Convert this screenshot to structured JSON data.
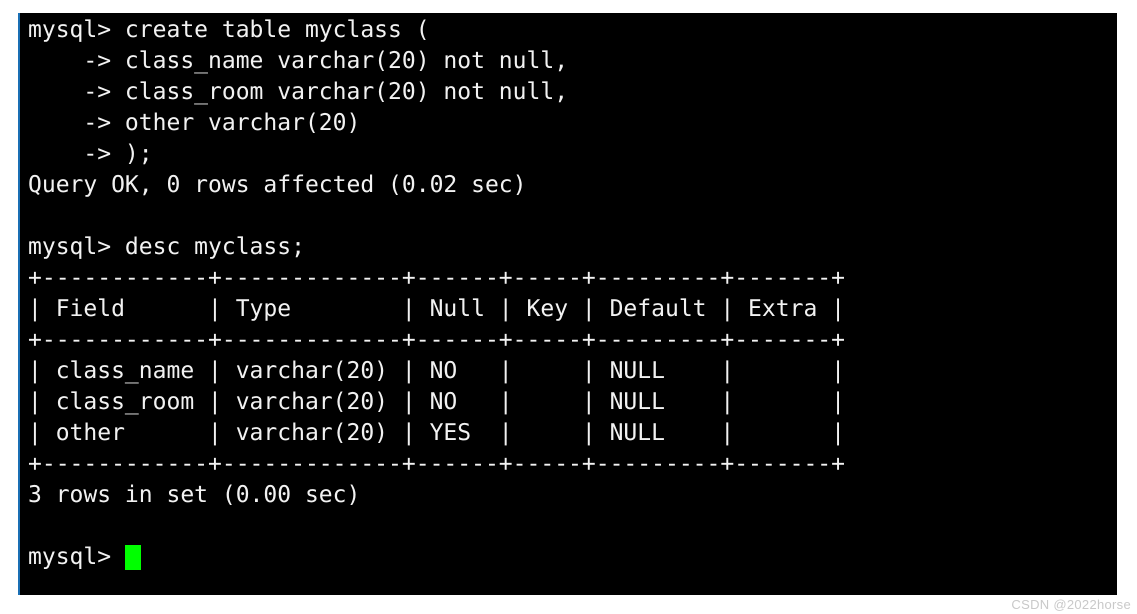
{
  "terminal": {
    "title": "mysql client session",
    "background_color": "#000000",
    "text_color": "#f2f2f2",
    "cursor_color": "#00ff00",
    "border_color": "#1a6fb4",
    "prompt": "mysql>",
    "continuation_prompt": "->",
    "lines": [
      "mysql> create table myclass (",
      "    -> class_name varchar(20) not null,",
      "    -> class_room varchar(20) not null,",
      "    -> other varchar(20)",
      "    -> );",
      "Query OK, 0 rows affected (0.02 sec)",
      "",
      "mysql> desc myclass;",
      "+------------+-------------+------+-----+---------+-------+",
      "| Field      | Type        | Null | Key | Default | Extra |",
      "+------------+-------------+------+-----+---------+-------+",
      "| class_name | varchar(20) | NO   |     | NULL    |       |",
      "| class_room | varchar(20) | NO   |     | NULL    |       |",
      "| other      | varchar(20) | YES  |     | NULL    |       |",
      "+------------+-------------+------+-----+---------+-------+",
      "3 rows in set (0.00 sec)",
      ""
    ],
    "final_prompt": "mysql> ",
    "cursor": "block-cursor"
  },
  "sql": {
    "create_statement": {
      "table_name": "myclass",
      "columns": [
        {
          "name": "class_name",
          "type": "varchar(20)",
          "constraint": "not null"
        },
        {
          "name": "class_room",
          "type": "varchar(20)",
          "constraint": "not null"
        },
        {
          "name": "other",
          "type": "varchar(20)",
          "constraint": ""
        }
      ],
      "result": "Query OK, 0 rows affected (0.02 sec)"
    },
    "desc_statement": {
      "command": "desc myclass;",
      "headers": [
        "Field",
        "Type",
        "Null",
        "Key",
        "Default",
        "Extra"
      ],
      "rows": [
        [
          "class_name",
          "varchar(20)",
          "NO",
          "",
          "NULL",
          ""
        ],
        [
          "class_room",
          "varchar(20)",
          "NO",
          "",
          "NULL",
          ""
        ],
        [
          "other",
          "varchar(20)",
          "YES",
          "",
          "NULL",
          ""
        ]
      ],
      "result": "3 rows in set (0.00 sec)"
    }
  },
  "watermark": {
    "text": "CSDN @2022horse"
  }
}
